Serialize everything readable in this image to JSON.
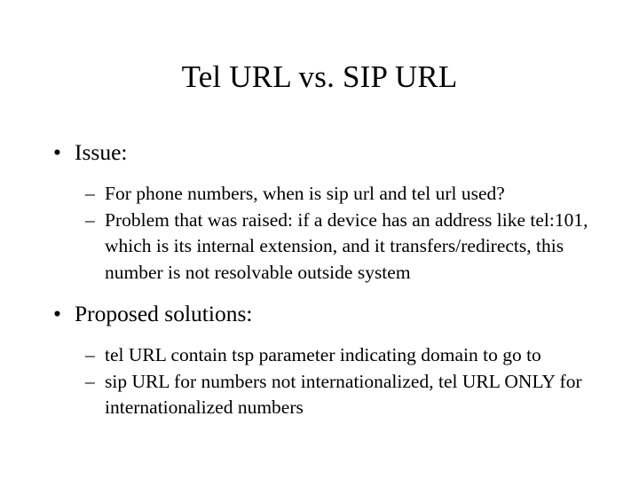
{
  "slide": {
    "title": "Tel URL vs. SIP URL",
    "background_color": "#ffffff",
    "text_color": "#000000",
    "bullet_glyph_level1": "•",
    "bullet_glyph_level2": "–",
    "content": [
      {
        "level": 1,
        "marker": "•",
        "text": "Issue:"
      },
      {
        "level": 2,
        "marker": "–",
        "text": "For phone numbers, when is sip url and tel url used?"
      },
      {
        "level": 2,
        "marker": "–",
        "text": "Problem that was raised: if a device has an address like tel:101, which is its internal extension, and it transfers/redirects, this number is not resolvable outside system"
      },
      {
        "level": 1,
        "marker": "•",
        "text": "Proposed solutions:"
      },
      {
        "level": 2,
        "marker": "–",
        "text": "tel URL contain tsp parameter indicating domain to go to"
      },
      {
        "level": 2,
        "marker": "–",
        "text": "sip URL for numbers not internationalized, tel URL ONLY for internationalized numbers"
      }
    ]
  }
}
